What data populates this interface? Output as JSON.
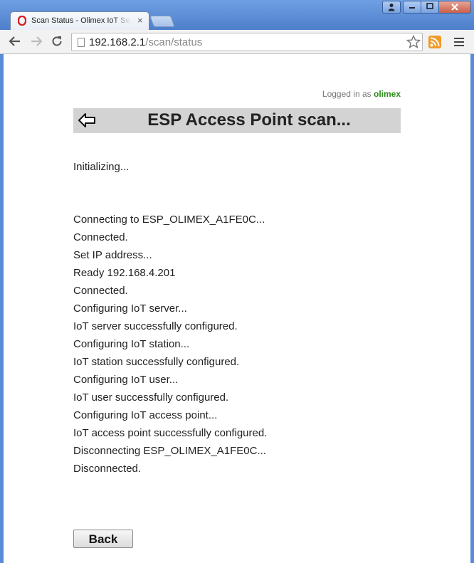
{
  "browser": {
    "tab_title": "Scan Status - Olimex IoT Ser",
    "tab_close": "×",
    "url_host": "192.168.2.1",
    "url_path": "/scan/status",
    "window_buttons": {
      "user": "👤",
      "minimize": "—",
      "maximize": "□",
      "close": "✕"
    }
  },
  "page": {
    "logged_in_prefix": "Logged in as",
    "logged_in_user": "olimex",
    "title": "ESP Access Point scan...",
    "initializing": "Initializing...",
    "status_lines": [
      "Connecting to ESP_OLIMEX_A1FE0C...",
      "Connected.",
      "Set IP address...",
      "Ready 192.168.4.201",
      "Connected.",
      "Configuring IoT server...",
      "IoT server successfully configured.",
      "Configuring IoT station...",
      "IoT station successfully configured.",
      "Configuring IoT user...",
      "IoT user successfully configured.",
      "Configuring IoT access point...",
      "IoT access point successfully configured.",
      "Disconnecting ESP_OLIMEX_A1FE0C...",
      "Disconnected."
    ],
    "back_button": "Back"
  },
  "colors": {
    "header_bg": "#d3d3d3",
    "username": "#2b8a1a",
    "titlebar": "#5a8bd6"
  }
}
